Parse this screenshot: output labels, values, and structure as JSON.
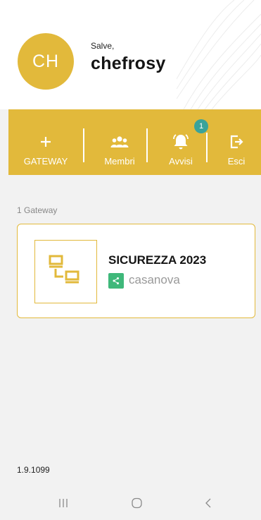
{
  "header": {
    "avatar_initials": "CH",
    "greeting": "Salve,",
    "username": "chefrosy"
  },
  "toolbar": {
    "items": [
      {
        "label": "GATEWAY",
        "icon": "plus-icon"
      },
      {
        "label": "Membri",
        "icon": "group-icon"
      },
      {
        "label": "Avvisi",
        "icon": "bell-icon",
        "badge": "1"
      },
      {
        "label": "Esci",
        "icon": "logout-icon"
      }
    ]
  },
  "gateways": {
    "count_label": "1 Gateway",
    "items": [
      {
        "title": "SICUREZZA 2023",
        "owner": "casanova",
        "icon": "network-icon",
        "shared_icon": "share-icon"
      }
    ]
  },
  "footer": {
    "version": "1.9.1099"
  },
  "system_nav": {
    "buttons": [
      "recent-apps-icon",
      "home-icon",
      "back-icon"
    ]
  },
  "colors": {
    "accent": "#e2b93b",
    "badge": "#3aa39a",
    "share": "#3fb87a",
    "background": "#f2f2f2"
  }
}
